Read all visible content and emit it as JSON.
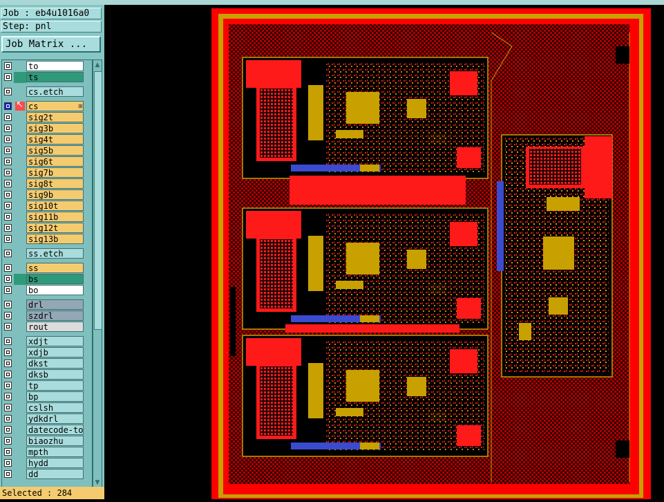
{
  "app": {
    "job_label": "Job : eb4u1016a0",
    "step_label": "Step: pnl",
    "job_matrix_button": "Job Matrix ...",
    "status_text": "Selected : 284"
  },
  "colors": {
    "panel_bg": "#86c6c4",
    "pcb_copper": "#ff0000",
    "pcb_gold": "#c8a000",
    "canvas_bg": "#000000"
  },
  "layers": [
    {
      "name": "to",
      "bg": "bgw",
      "gap_before": 0
    },
    {
      "name": "ts",
      "bg": "bgg",
      "gap_before": 0
    },
    {
      "name": "cs.etch",
      "bg": "bgc",
      "gap_before": 5
    },
    {
      "name": "cs",
      "bg": "bgo",
      "gap_before": 5,
      "active": true
    },
    {
      "name": "sig2t",
      "bg": "bgo",
      "gap_before": 0
    },
    {
      "name": "sig3b",
      "bg": "bgo",
      "gap_before": 0
    },
    {
      "name": "sig4t",
      "bg": "bgo",
      "gap_before": 0
    },
    {
      "name": "sig5b",
      "bg": "bgo",
      "gap_before": 0
    },
    {
      "name": "sig6t",
      "bg": "bgo",
      "gap_before": 0
    },
    {
      "name": "sig7b",
      "bg": "bgo",
      "gap_before": 0
    },
    {
      "name": "sig8t",
      "bg": "bgo",
      "gap_before": 0
    },
    {
      "name": "sig9b",
      "bg": "bgo",
      "gap_before": 0
    },
    {
      "name": "sig10t",
      "bg": "bgo",
      "gap_before": 0
    },
    {
      "name": "sig11b",
      "bg": "bgo",
      "gap_before": 0
    },
    {
      "name": "sig12t",
      "bg": "bgo",
      "gap_before": 0
    },
    {
      "name": "sig13b",
      "bg": "bgo",
      "gap_before": 0
    },
    {
      "name": "ss.etch",
      "bg": "bgc",
      "gap_before": 5
    },
    {
      "name": "ss",
      "bg": "bgo",
      "gap_before": 5
    },
    {
      "name": "bs",
      "bg": "bgg",
      "gap_before": 0
    },
    {
      "name": "bo",
      "bg": "bgw",
      "gap_before": 0
    },
    {
      "name": "drl",
      "bg": "bgs",
      "gap_before": 5
    },
    {
      "name": "szdrl",
      "bg": "bgs",
      "gap_before": 0
    },
    {
      "name": "rout",
      "bg": "bgl",
      "gap_before": 0
    },
    {
      "name": "xdjt",
      "bg": "bgc",
      "gap_before": 5
    },
    {
      "name": "xdjb",
      "bg": "bgc",
      "gap_before": 0
    },
    {
      "name": "dkst",
      "bg": "bgc",
      "gap_before": 0
    },
    {
      "name": "dksb",
      "bg": "bgc",
      "gap_before": 0
    },
    {
      "name": "tp",
      "bg": "bgc",
      "gap_before": 0
    },
    {
      "name": "bp",
      "bg": "bgc",
      "gap_before": 0
    },
    {
      "name": "cslsh",
      "bg": "bgc",
      "gap_before": 0
    },
    {
      "name": "ydkdrl",
      "bg": "bgc",
      "gap_before": 0
    },
    {
      "name": "datecode-to",
      "bg": "bgc",
      "gap_before": 0
    },
    {
      "name": "biaozhu",
      "bg": "bgc",
      "gap_before": 0
    },
    {
      "name": "mpth",
      "bg": "bgc",
      "gap_before": 0
    },
    {
      "name": "hydd",
      "bg": "bgc",
      "gap_before": 0
    },
    {
      "name": "dd",
      "bg": "bgc",
      "gap_before": 0
    }
  ],
  "icons": {
    "checkbox": "checkbox-icon",
    "active_arrow": "pointer-arrow-icon",
    "grid": "grid-icon",
    "scroll_up": "scroll-up-icon",
    "scroll_down": "scroll-down-icon"
  }
}
